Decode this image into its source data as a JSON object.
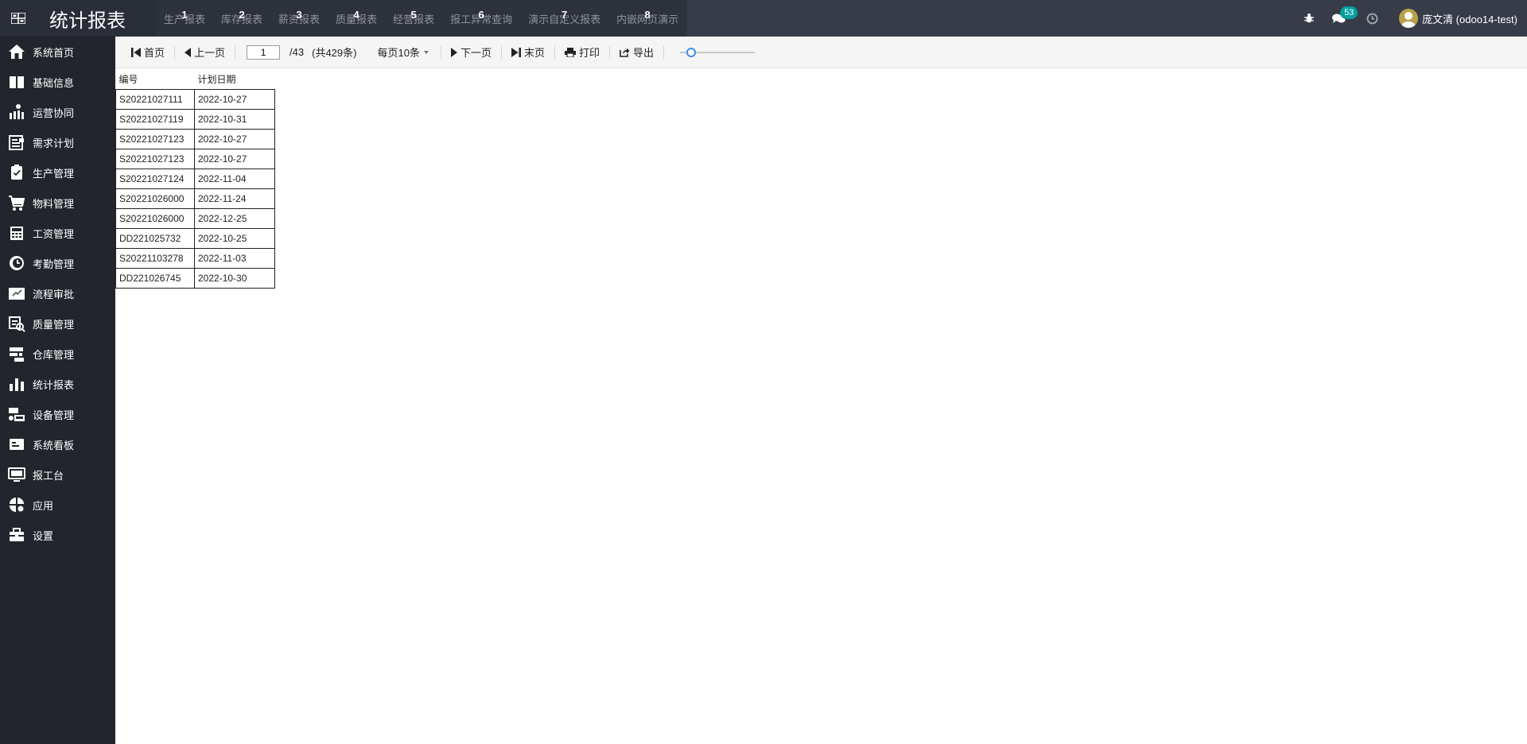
{
  "header": {
    "title": "统计报表",
    "menu": [
      {
        "label": "生产报表",
        "key": "1"
      },
      {
        "label": "库存报表",
        "key": "2"
      },
      {
        "label": "薪资报表",
        "key": "3"
      },
      {
        "label": "质量报表",
        "key": "4"
      },
      {
        "label": "经营报表",
        "key": "5"
      },
      {
        "label": "报工异常查询",
        "key": "6"
      },
      {
        "label": "演示自定义报表",
        "key": "7"
      },
      {
        "label": "内嵌网页演示",
        "key": "8"
      }
    ],
    "messages_count": "53",
    "user_name": "庞文清 (odoo14-test)"
  },
  "sidebar": {
    "items": [
      {
        "label": "系统首页",
        "icon": "home-icon"
      },
      {
        "label": "基础信息",
        "icon": "book-icon"
      },
      {
        "label": "运营协同",
        "icon": "operations-icon"
      },
      {
        "label": "需求计划",
        "icon": "plan-icon"
      },
      {
        "label": "生产管理",
        "icon": "clipboard-icon"
      },
      {
        "label": "物料管理",
        "icon": "cart-icon"
      },
      {
        "label": "工资管理",
        "icon": "calculator-icon"
      },
      {
        "label": "考勤管理",
        "icon": "clock-icon"
      },
      {
        "label": "流程审批",
        "icon": "approval-icon"
      },
      {
        "label": "质量管理",
        "icon": "quality-icon"
      },
      {
        "label": "仓库管理",
        "icon": "warehouse-icon"
      },
      {
        "label": "统计报表",
        "icon": "bar-chart-icon"
      },
      {
        "label": "设备管理",
        "icon": "equipment-icon"
      },
      {
        "label": "系统看板",
        "icon": "dashboard-icon"
      },
      {
        "label": "报工台",
        "icon": "monitor-icon"
      },
      {
        "label": "应用",
        "icon": "apps-icon"
      },
      {
        "label": "设置",
        "icon": "toolbox-icon"
      }
    ]
  },
  "toolbar": {
    "first": "首页",
    "prev": "上一页",
    "page_value": "1",
    "page_total": "/43",
    "record_count": "(共429条)",
    "per_page": "每页10条",
    "next": "下一页",
    "last": "末页",
    "print": "打印",
    "export": "导出",
    "zoom_level": 0.1
  },
  "report": {
    "columns": [
      "编号",
      "计划日期"
    ],
    "rows": [
      [
        "S20221027111",
        "2022-10-27"
      ],
      [
        "S20221027119",
        "2022-10-31"
      ],
      [
        "S20221027123",
        "2022-10-27"
      ],
      [
        "S20221027123",
        "2022-10-27"
      ],
      [
        "S20221027124",
        "2022-11-04"
      ],
      [
        "S20221026000",
        "2022-11-24"
      ],
      [
        "S20221026000",
        "2022-12-25"
      ],
      [
        "DD221025732",
        "2022-10-25"
      ],
      [
        "S20221103278",
        "2022-11-03"
      ],
      [
        "DD221026745",
        "2022-10-30"
      ]
    ]
  }
}
